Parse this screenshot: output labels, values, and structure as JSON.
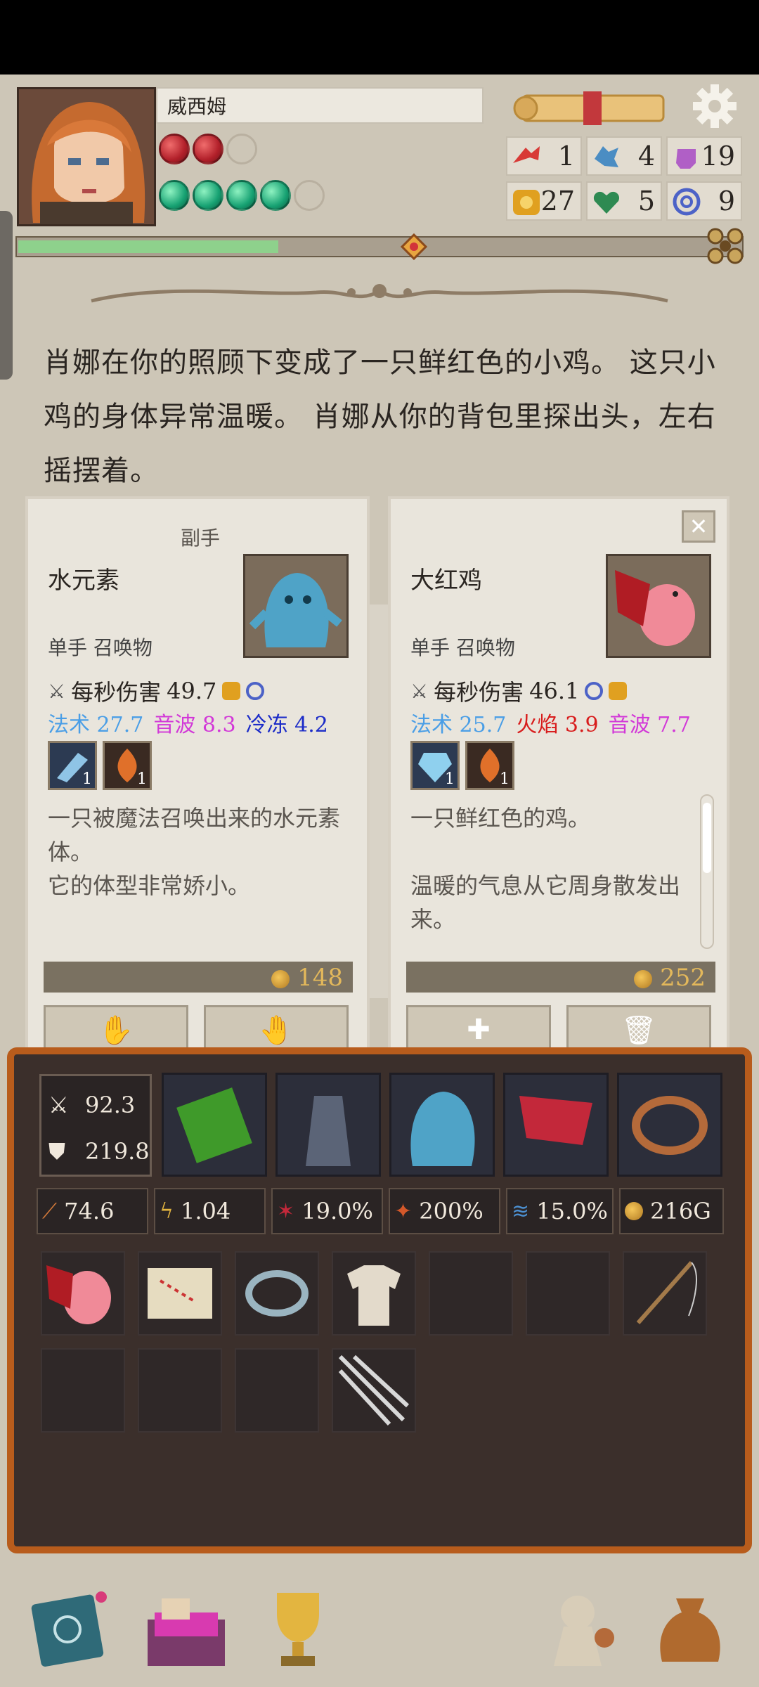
{
  "player": {
    "name": "威西姆",
    "hearts_filled": 2,
    "hearts_total": 3,
    "stamina_filled": 4,
    "stamina_total": 5
  },
  "resources": [
    {
      "icon": "red-arrow-icon",
      "value": "1",
      "color": "#d83a36"
    },
    {
      "icon": "blue-splash-icon",
      "value": "4",
      "color": "#4b8dc3"
    },
    {
      "icon": "purple-potion-icon",
      "value": "19",
      "color": "#b05fc6"
    },
    {
      "icon": "gold-ring-icon",
      "value": "27",
      "color": "#e0a020"
    },
    {
      "icon": "green-heart-icon",
      "value": "5",
      "color": "#2e8a52"
    },
    {
      "icon": "blue-spiral-icon",
      "value": "9",
      "color": "#4c62c7"
    }
  ],
  "xp_fraction": 0.36,
  "story": "肖娜在你的照顾下变成了一只鲜红色的小鸡。 这只小鸡的身体异常温暖。 肖娜从你的背包里探出头，左右摇摆着。",
  "card_left": {
    "header": "副手",
    "name": "水元素",
    "type": "单手 召唤物",
    "dps_label": "每秒伤害",
    "dps": "49.7",
    "effects": [
      {
        "label": "法术",
        "value": "27.7",
        "color": "#4a9ee6"
      },
      {
        "label": "音波",
        "value": "8.3",
        "color": "#d238d8"
      },
      {
        "label": "冷冻",
        "value": "4.2",
        "color": "#1c2cc8"
      }
    ],
    "gem_counts": [
      "1",
      "1"
    ],
    "description": "一只被魔法召唤出来的水元素体。\n 它的体型非常娇小。",
    "price": "148"
  },
  "card_right": {
    "name": "大红鸡",
    "type": "单手 召唤物",
    "dps_label": "每秒伤害",
    "dps": "46.1",
    "effects": [
      {
        "label": "法术",
        "value": "25.7",
        "color": "#4a9ee6"
      },
      {
        "label": "火焰",
        "value": "3.9",
        "color": "#d81c1c"
      },
      {
        "label": "音波",
        "value": "7.7",
        "color": "#d238d8"
      }
    ],
    "gem_counts": [
      "1",
      "1"
    ],
    "description": "一只鲜红色的鸡。\n\n温暖的气息从它周身散发出来。",
    "price": "252"
  },
  "combat": {
    "attack": "92.3",
    "defense": "219.8"
  },
  "attributes": [
    {
      "icon": "attack-boost-icon",
      "value": "74.6"
    },
    {
      "icon": "speed-icon",
      "value": "1.04"
    },
    {
      "icon": "crit-chance-icon",
      "value": "19.0%"
    },
    {
      "icon": "crit-damage-icon",
      "value": "200%"
    },
    {
      "icon": "dodge-icon",
      "value": "15.0%"
    }
  ],
  "gold": "216G"
}
